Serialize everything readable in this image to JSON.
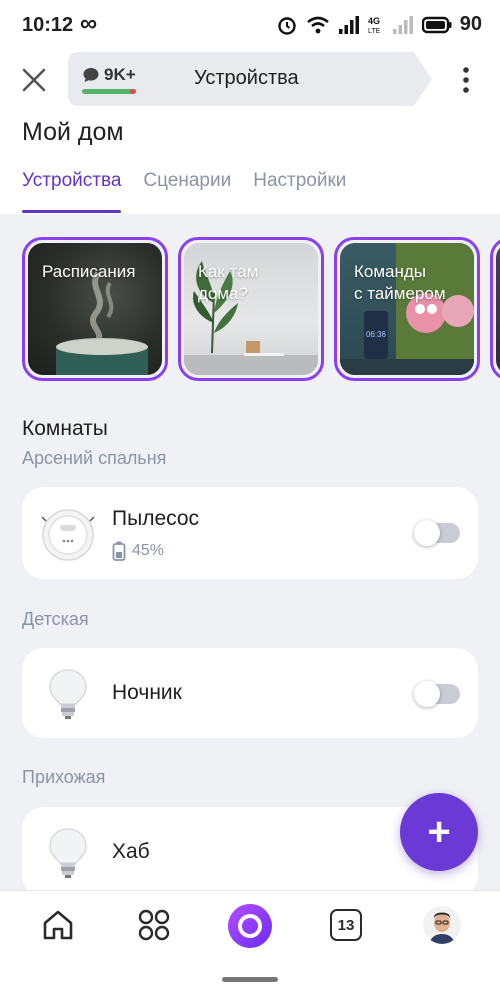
{
  "status_bar": {
    "time": "10:12",
    "infinity_symbol": "∞",
    "network_label": "4G LTE",
    "battery_level": "90",
    "icons": [
      "alarm-icon",
      "wifi-icon",
      "signal-icon",
      "signal-weak-icon",
      "battery-icon"
    ]
  },
  "top_bar": {
    "chat_count": "9K+",
    "title": "Устройства",
    "icons": [
      "close-icon",
      "chat-icon",
      "more-vert-icon"
    ]
  },
  "header": {
    "title": "Мой дом",
    "tabs": [
      {
        "label": "Устройства",
        "active": true
      },
      {
        "label": "Сценарии",
        "active": false
      },
      {
        "label": "Настройки",
        "active": false
      }
    ]
  },
  "stories": [
    {
      "label": "Расписания"
    },
    {
      "label_line1": "Как там",
      "label_line2": "дома?"
    },
    {
      "label_line1": "Команды",
      "label_line2": "с таймером",
      "screen_text": "06:36"
    }
  ],
  "rooms_section": {
    "title": "Комнаты",
    "rooms": [
      {
        "name": "Арсений спальня",
        "device": {
          "name": "Пылесос",
          "battery": "45%",
          "on": false,
          "icon": "robot-vacuum-icon"
        }
      },
      {
        "name": "Детская",
        "device": {
          "name": "Ночник",
          "on": false,
          "icon": "light-bulb-icon"
        }
      },
      {
        "name": "Прихожая",
        "device": {
          "name": "Хаб",
          "icon": "light-bulb-icon"
        }
      }
    ]
  },
  "fab": {
    "label": "+"
  },
  "bottom_nav": {
    "calendar_badge": "13",
    "items": [
      "home-icon",
      "grid-icon",
      "alice-icon",
      "calendar-icon",
      "profile-avatar"
    ]
  },
  "colors": {
    "accent": "#6333c7",
    "story_border": "#8a3ff0",
    "background": "#f0f1f5",
    "secondary_text": "#8a93a8"
  }
}
